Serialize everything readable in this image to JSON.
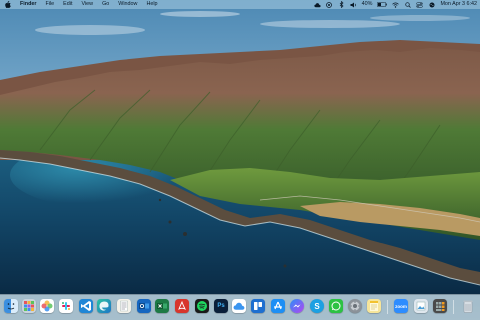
{
  "menubar": {
    "app_name": "Finder",
    "menus": [
      "File",
      "Edit",
      "View",
      "Go",
      "Window",
      "Help"
    ],
    "battery_percent": "40%",
    "datetime": "Mon Apr 3  6:42"
  },
  "desktop": {
    "wallpaper": "big-sur-coastline"
  },
  "dock": {
    "apps": [
      {
        "name": "Finder",
        "icon": "finder-icon"
      },
      {
        "name": "Launchpad",
        "icon": "launchpad-icon"
      },
      {
        "name": "Photos",
        "icon": "photos-icon"
      },
      {
        "name": "Slack",
        "icon": "slack-icon"
      },
      {
        "name": "Visual Studio Code",
        "icon": "vscode-icon"
      },
      {
        "name": "Microsoft Edge",
        "icon": "edge-icon"
      },
      {
        "name": "TextEdit",
        "icon": "textedit-icon"
      },
      {
        "name": "Microsoft Outlook",
        "icon": "outlook-icon"
      },
      {
        "name": "Microsoft Excel",
        "icon": "excel-icon"
      },
      {
        "name": "PDF Reader",
        "icon": "pdf-icon"
      },
      {
        "name": "Spotify",
        "icon": "spotify-icon"
      },
      {
        "name": "Photoshop",
        "icon": "photoshop-icon",
        "glyph": "Ps"
      },
      {
        "name": "iCloud",
        "icon": "icloud-icon"
      },
      {
        "name": "Trello",
        "icon": "trello-icon"
      },
      {
        "name": "App Store",
        "icon": "appstore-icon"
      },
      {
        "name": "Messenger",
        "icon": "messenger-icon"
      },
      {
        "name": "Skype",
        "icon": "skype-icon",
        "glyph": "S"
      },
      {
        "name": "WhatsApp",
        "icon": "whatsapp-icon"
      },
      {
        "name": "System Preferences",
        "icon": "settings-icon"
      },
      {
        "name": "Notes",
        "icon": "notes-icon"
      },
      {
        "name": "Zoom",
        "icon": "zoom-icon",
        "glyph": "zoom"
      },
      {
        "name": "Preview",
        "icon": "preview-icon"
      },
      {
        "name": "Calculator",
        "icon": "calculator-icon"
      },
      {
        "name": "Trash",
        "icon": "trash-icon"
      }
    ]
  },
  "colors": {
    "menubar_bg": "#aacde1",
    "dock_bg": "#8ca5b4",
    "ocean_deep": "#0d3553",
    "hills_green": "#4f7a36"
  }
}
